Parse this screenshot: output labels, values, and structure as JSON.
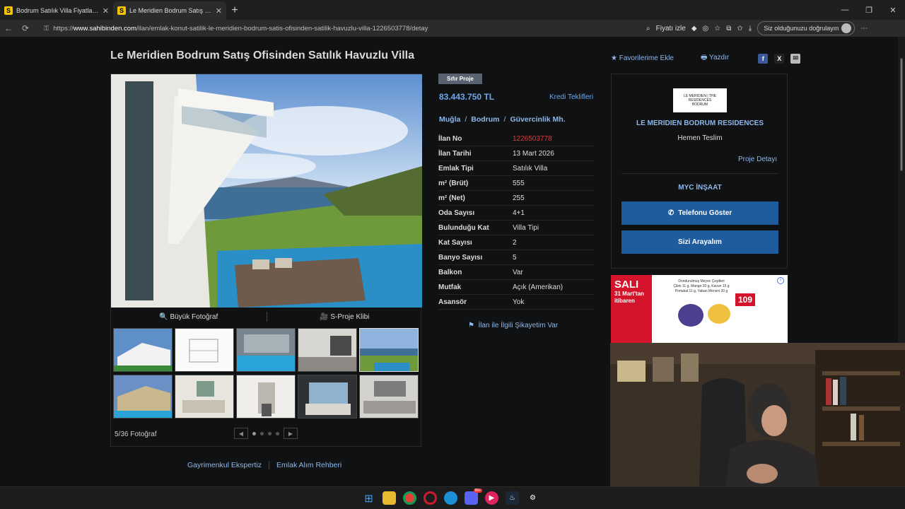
{
  "browser": {
    "tabs": [
      {
        "label": "Bodrum Satılık Villa Fiyatları ve Vill",
        "favicon": "S",
        "active": false
      },
      {
        "label": "Le Meridien Bodrum Satış Ofisinden",
        "favicon": "S",
        "active": true
      }
    ],
    "url_prefix": "https://",
    "url_domain": "www.sahibinden.com",
    "url_path": "/ilan/emlak-konut-satilik-le-meridien-bodrum-satis-ofisinden-satilik-havuzlu-villa-1226503778/detay",
    "price_watch_label": "Fiyatı izle",
    "signin_label": "Siz olduğunuzu doğrulayın"
  },
  "listing": {
    "title": "Le Meridien Bodrum Satış Ofisinden Satılık Havuzlu Villa",
    "favorites_label": "Favorilerime Ekle",
    "print_label": "Yazdır",
    "badge": "Sıfır Proje",
    "price": "83.443.750 TL",
    "credit_label": "Kredi Teklifleri",
    "location": [
      "Muğla",
      "Bodrum",
      "Güvercinlik Mh."
    ],
    "details": [
      {
        "key": "İlan No",
        "value": "1226503778"
      },
      {
        "key": "İlan Tarihi",
        "value": "13 Mart 2026"
      },
      {
        "key": "Emlak Tipi",
        "value": "Satılık Villa"
      },
      {
        "key": "m² (Brüt)",
        "value": "555"
      },
      {
        "key": "m² (Net)",
        "value": "255"
      },
      {
        "key": "Oda Sayısı",
        "value": "4+1"
      },
      {
        "key": "Bulunduğu Kat",
        "value": "Villa Tipi"
      },
      {
        "key": "Kat Sayısı",
        "value": "2"
      },
      {
        "key": "Banyo Sayısı",
        "value": "5"
      },
      {
        "key": "Balkon",
        "value": "Var"
      },
      {
        "key": "Mutfak",
        "value": "Açık (Amerikan)"
      },
      {
        "key": "Asansör",
        "value": "Yok"
      }
    ],
    "complaint_label": "İlan ile İlgili Şikayetim Var"
  },
  "gallery": {
    "big_photo_label": "Büyük Fotoğraf",
    "video_label": "S-Proje Klibi",
    "counter": "5/36 Fotoğraf"
  },
  "sidebar": {
    "logo_text": "LE MERIDIEN | THE RESIDENCES BODRUM",
    "project_name": "LE MERIDIEN BODRUM RESIDENCES",
    "project_status": "Hemen Teslim",
    "project_detail_label": "Proje Detayı",
    "company": "MYC İNŞAAT",
    "phone_button": "Telefonu Göster",
    "call_button": "Sizi Arayalım"
  },
  "ad": {
    "day": "SALI",
    "date_line1": "31 Mart'tan",
    "date_line2": "itibaren",
    "text_lines": [
      "Dondurulmuş Meyve Çeşitleri",
      "Çilek 11 g, Mango 20 g, Kavun 15 g",
      "Portakal 11 g, Yaban Mersini 20 g"
    ],
    "price": "109"
  },
  "footer": {
    "links": [
      "Gayrimenkul Ekspertiz",
      "Emlak Alım Rehberi"
    ]
  },
  "taskbar": {
    "badge_count": "99+"
  }
}
